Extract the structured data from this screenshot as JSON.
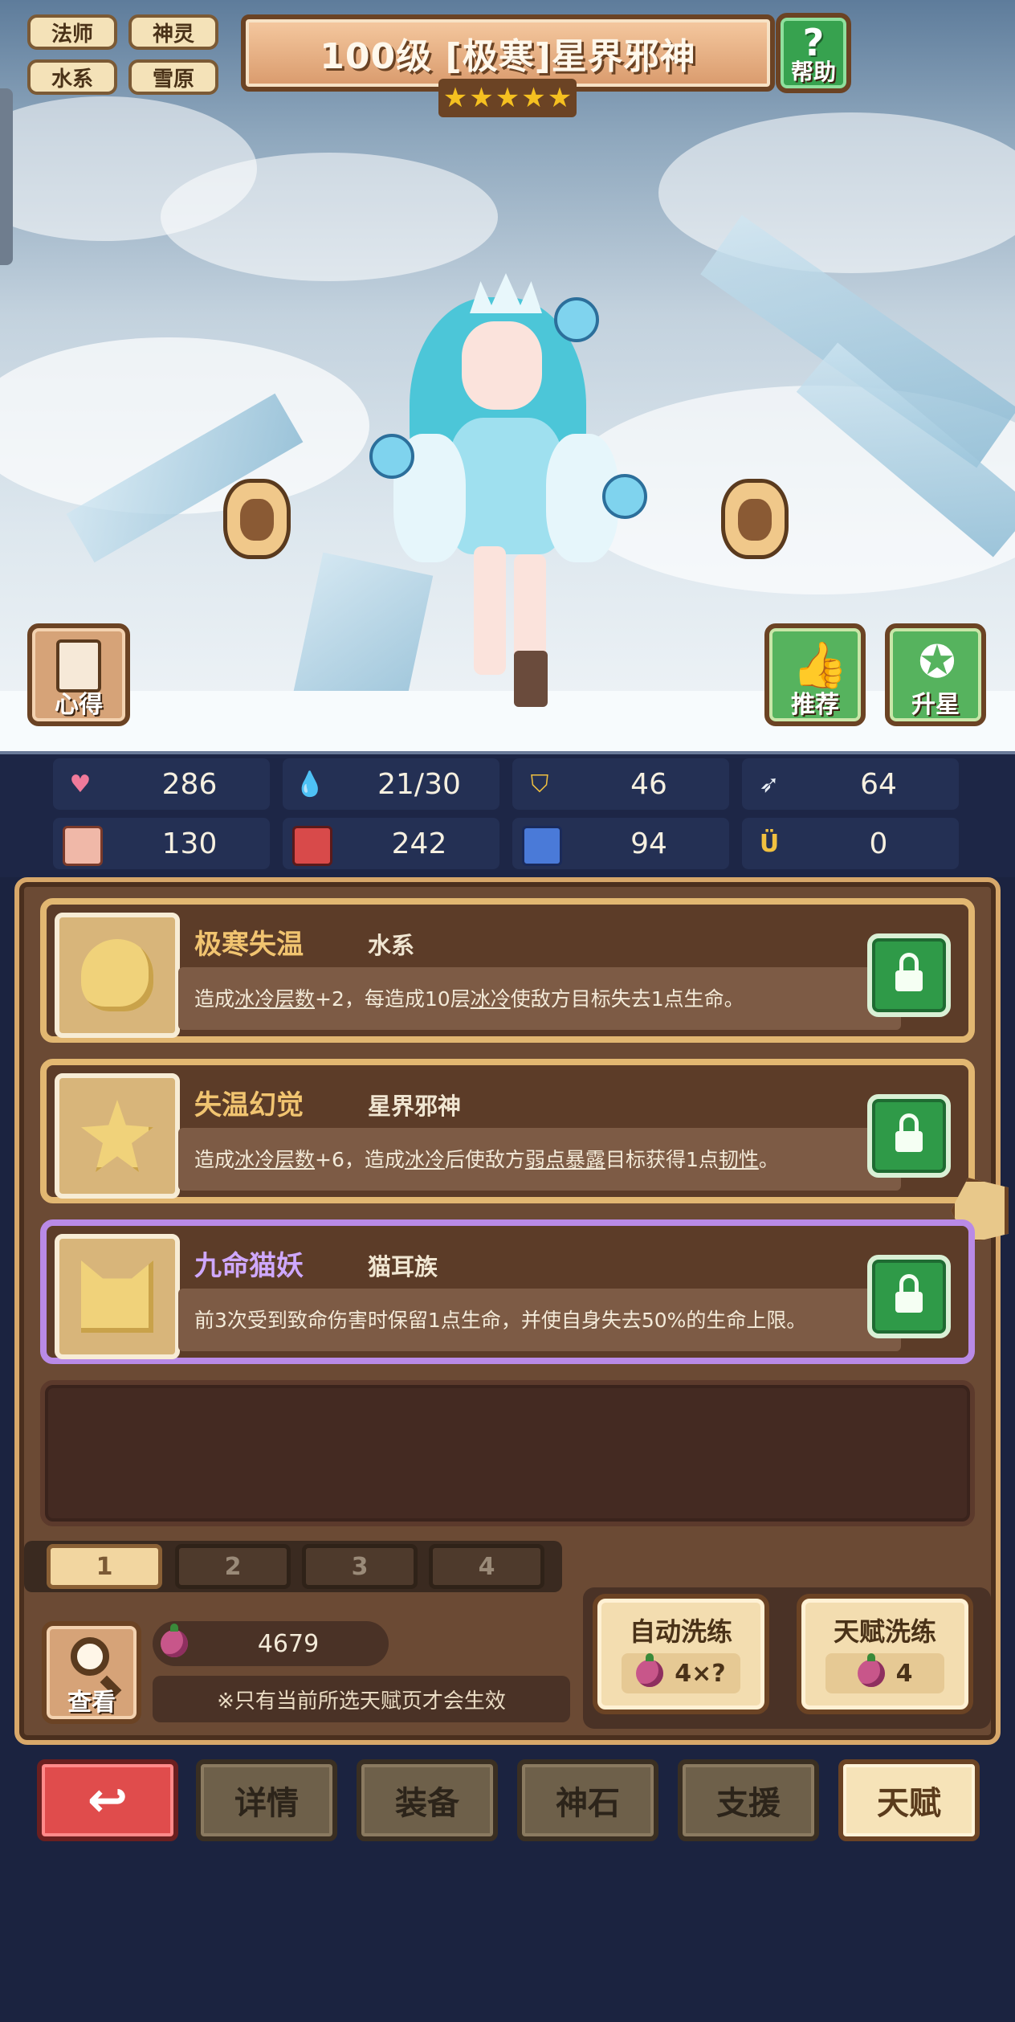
{
  "tags": [
    "法师",
    "神灵",
    "水系",
    "雪原"
  ],
  "header": {
    "title": "100级 [极寒]星界邪神",
    "stars": 5,
    "help_icon": "?",
    "help_label": "帮助"
  },
  "scene_buttons": {
    "notes": "心得",
    "recommend": "推荐",
    "star_up": "升星"
  },
  "stats": [
    {
      "icon": "heart-icon",
      "value": "286"
    },
    {
      "icon": "mana-drop-icon",
      "value": "21/30"
    },
    {
      "icon": "shield-icon",
      "value": "46"
    },
    {
      "icon": "wing-icon",
      "value": "64"
    },
    {
      "icon": "fist-icon",
      "value": "130"
    },
    {
      "icon": "spellbook-icon",
      "value": "242"
    },
    {
      "icon": "boot-icon",
      "value": "94"
    },
    {
      "icon": "horseshoe-icon",
      "value": "0"
    }
  ],
  "talents": [
    {
      "name": "极寒失温",
      "tag": "水系",
      "desc_parts": [
        "造成",
        "冰冷层数",
        "+2，每造成10层",
        "冰冷",
        "使敌方目标失去1点生命。"
      ]
    },
    {
      "name": "失温幻觉",
      "tag": "星界邪神",
      "desc_parts": [
        "造成",
        "冰冷层数",
        "+6，造成",
        "冰冷",
        "后使敌方",
        "弱点暴露",
        "目标获得1点",
        "韧性",
        "。"
      ]
    },
    {
      "name": "九命猫妖",
      "tag": "猫耳族",
      "desc_parts": [
        "前3次受到致命伤害时保留1点生命，并使自身失去50%的生命上限。"
      ]
    }
  ],
  "page_tabs": [
    "1",
    "2",
    "3",
    "4"
  ],
  "active_page": "1",
  "view_button": "查看",
  "currency": "4679",
  "notice": "※只有当前所选天赋页才会生效",
  "auto_reroll": {
    "label": "自动洗练",
    "cost": "4×?"
  },
  "talent_reroll": {
    "label": "天赋洗练",
    "cost": "4"
  },
  "nav": {
    "back_icon": "↩",
    "tabs": [
      "详情",
      "装备",
      "神石",
      "支援",
      "天赋"
    ],
    "active": "天赋"
  },
  "colors": {
    "gold": "#f1c470",
    "purple": "#cfa8ff",
    "lock_green": "#2f9a48",
    "back_red": "#e04c4c"
  }
}
